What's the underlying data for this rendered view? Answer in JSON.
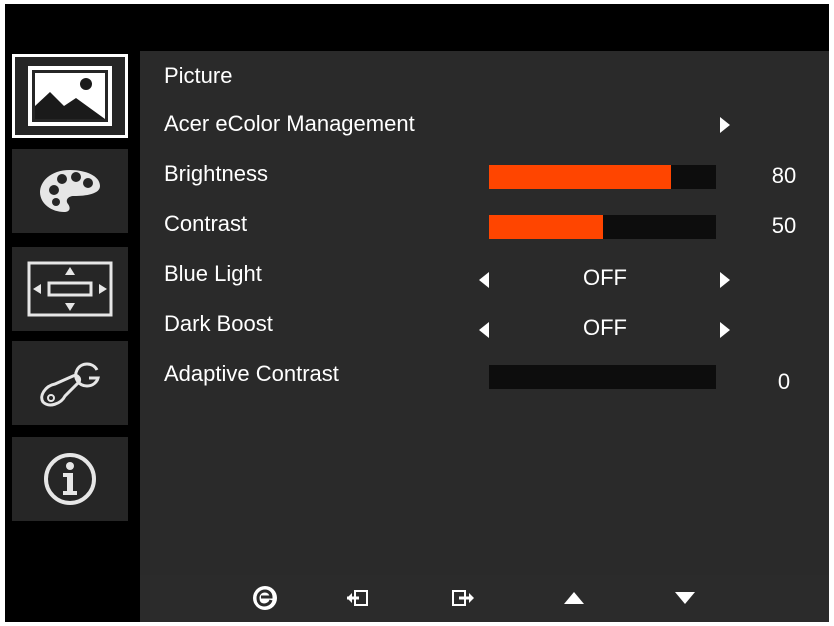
{
  "sidebar": {
    "items": [
      {
        "icon": "picture-icon",
        "active": true
      },
      {
        "icon": "color-palette-icon",
        "active": false
      },
      {
        "icon": "display-position-icon",
        "active": false
      },
      {
        "icon": "settings-icon",
        "active": false
      },
      {
        "icon": "info-icon",
        "active": false
      }
    ]
  },
  "panel": {
    "title": "Picture",
    "menu": {
      "ecolor_label": "Acer eColor Management",
      "brightness_label": "Brightness",
      "brightness_value": "80",
      "brightness_level": 80,
      "contrast_label": "Contrast",
      "contrast_value": "50",
      "contrast_level": 50,
      "bluelight_label": "Blue Light",
      "bluelight_value": "OFF",
      "darkboost_label": "Dark Boost",
      "darkboost_value": "OFF",
      "adaptive_label": "Adaptive Contrast",
      "adaptive_value": "0",
      "adaptive_level": 0
    }
  },
  "bottombar": {
    "buttons": [
      "e-logo-icon",
      "enter-icon",
      "exit-icon",
      "up-arrow-icon",
      "down-arrow-icon"
    ]
  },
  "colors": {
    "accent": "#ff4500",
    "panel": "#2a2a2a",
    "background": "#000000"
  }
}
